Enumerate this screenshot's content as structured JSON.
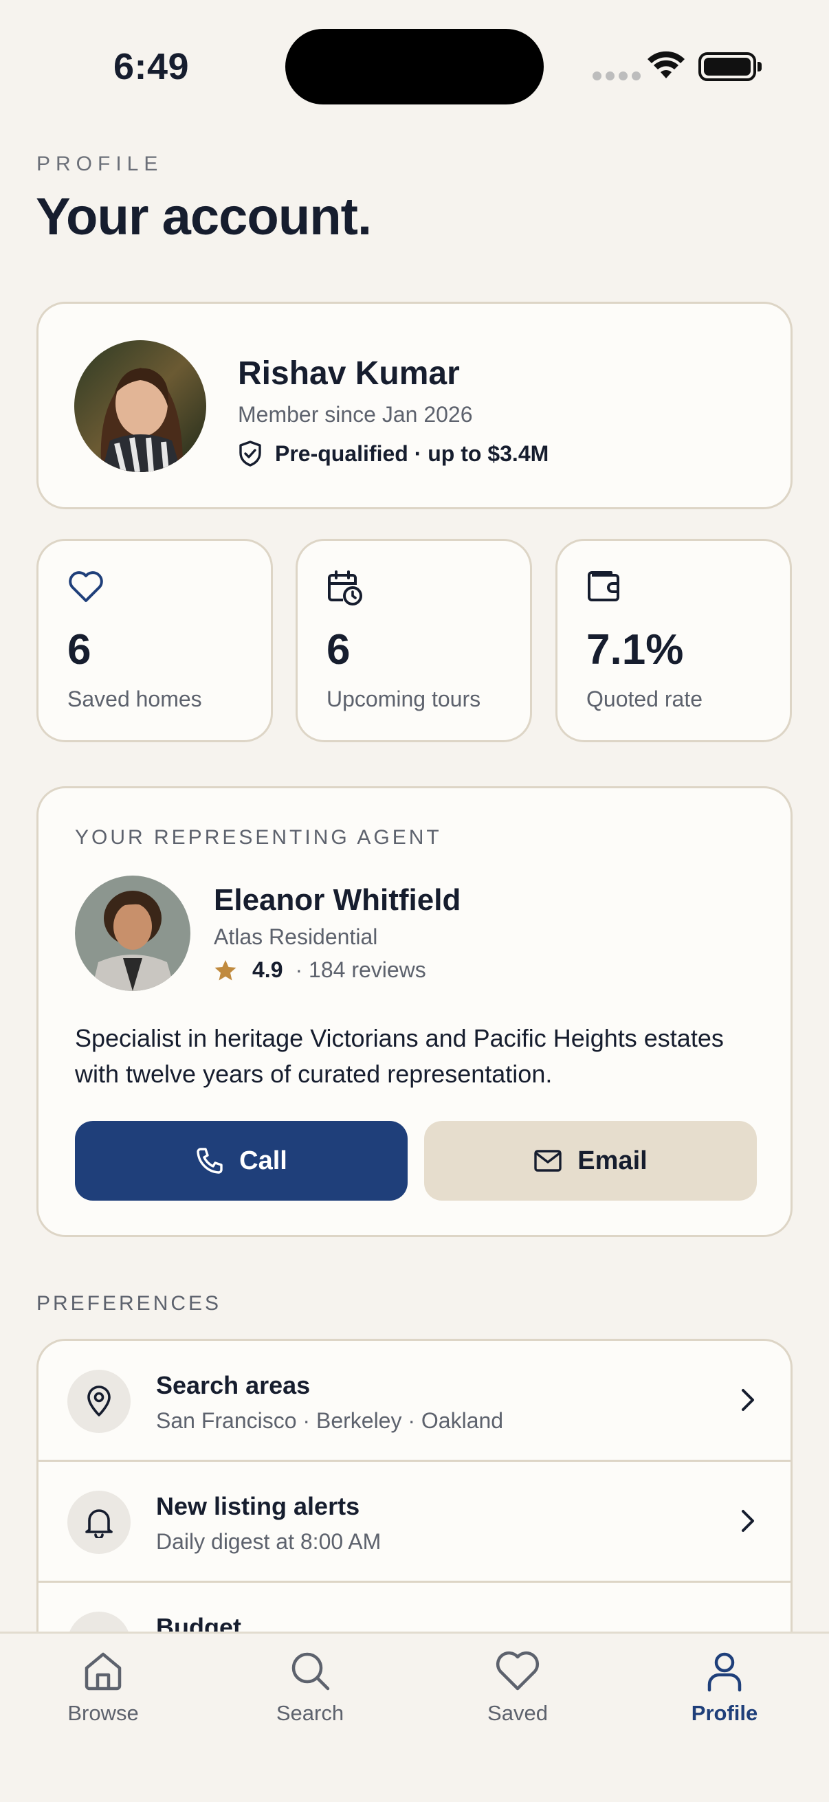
{
  "status_bar": {
    "time": "6:49"
  },
  "header": {
    "eyebrow": "PROFILE",
    "title": "Your account."
  },
  "profile": {
    "name": "Rishav Kumar",
    "member_since": "Member since Jan 2026",
    "prequal": "Pre-qualified · up to $3.4M"
  },
  "stats": [
    {
      "icon": "heart-icon",
      "value": "6",
      "label": "Saved homes"
    },
    {
      "icon": "calendar-clock-icon",
      "value": "6",
      "label": "Upcoming tours"
    },
    {
      "icon": "wallet-icon",
      "value": "7.1%",
      "label": "Quoted rate"
    }
  ],
  "agent": {
    "eyebrow": "YOUR REPRESENTING AGENT",
    "name": "Eleanor Whitfield",
    "brokerage": "Atlas Residential",
    "rating": "4.9",
    "reviews": "· 184 reviews",
    "bio": "Specialist in heritage Victorians and Pacific Heights estates with twelve years of curated representation.",
    "call_label": "Call",
    "email_label": "Email"
  },
  "preferences": {
    "label": "PREFERENCES",
    "items": [
      {
        "icon": "map-pin-icon",
        "title": "Search areas",
        "subtitle": "San Francisco · Berkeley · Oakland"
      },
      {
        "icon": "bell-icon",
        "title": "New listing alerts",
        "subtitle": "Daily digest at 8:00 AM"
      },
      {
        "icon": "budget-icon",
        "title": "Budget",
        "subtitle": ""
      }
    ]
  },
  "tab_bar": {
    "active": "Profile",
    "tabs": [
      {
        "icon": "home-icon",
        "label": "Browse"
      },
      {
        "icon": "search-icon",
        "label": "Search"
      },
      {
        "icon": "heart-icon",
        "label": "Saved"
      },
      {
        "icon": "user-icon",
        "label": "Profile"
      }
    ]
  },
  "colors": {
    "accent": "#1f3f7a",
    "star": "#c08a3e",
    "background": "#f6f3ee",
    "card_border": "#ddd5c6",
    "email_button": "#e6ddcd"
  }
}
